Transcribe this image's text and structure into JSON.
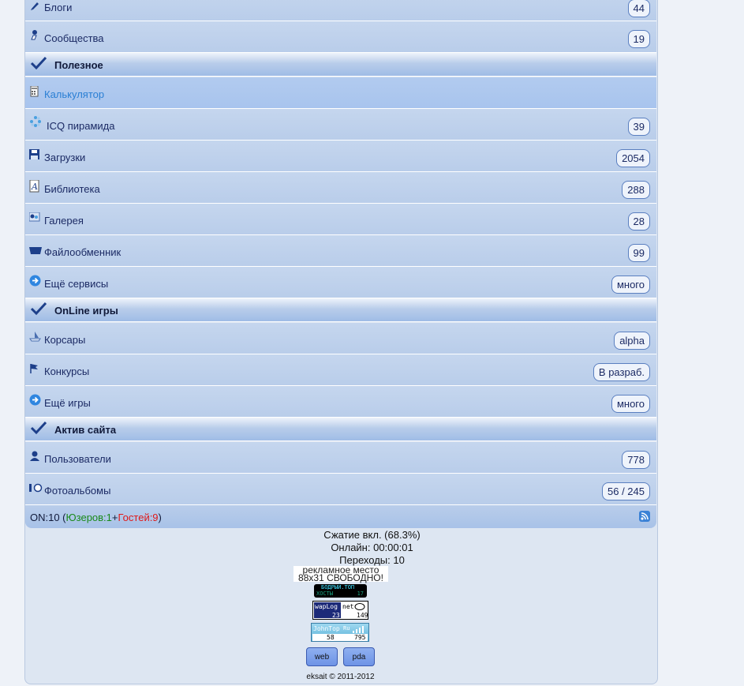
{
  "menu_top": [
    {
      "label": "Блоги",
      "count": "44",
      "icon": "pencil-icon"
    },
    {
      "label": "Сообщества",
      "count": "19",
      "icon": "community-icon"
    }
  ],
  "sections": {
    "useful": {
      "title": "Полезное"
    },
    "games": {
      "title": "OnLine игры"
    },
    "activity": {
      "title": "Актив сайта"
    }
  },
  "useful_items": [
    {
      "label": "Калькулятор",
      "count": "",
      "icon": "calculator-icon"
    },
    {
      "label": "ICQ пирамида",
      "count": "39",
      "icon": "icq-flower-icon"
    },
    {
      "label": "Загрузки",
      "count": "2054",
      "icon": "floppy-icon"
    },
    {
      "label": "Библиотека",
      "count": "288",
      "icon": "book-icon"
    },
    {
      "label": "Галерея",
      "count": "28",
      "icon": "gallery-icon"
    },
    {
      "label": "Файлообменник",
      "count": "99",
      "icon": "tray-icon"
    },
    {
      "label": "Ещё сервисы",
      "count": "много",
      "icon": "arrow-circle-icon"
    }
  ],
  "game_items": [
    {
      "label": "Корсары",
      "count": "alpha",
      "icon": "ship-icon"
    },
    {
      "label": "Конкурсы",
      "count": "В разраб.",
      "icon": "flag-icon"
    },
    {
      "label": "Ещё игры",
      "count": "много",
      "icon": "arrow-circle-icon"
    }
  ],
  "activity_items": [
    {
      "label": "Пользователи",
      "count": "778",
      "icon": "user-icon"
    },
    {
      "label": "Фотоальбомы",
      "count": "56 / 245",
      "icon": "camera-icon"
    }
  ],
  "online": {
    "prefix": "ON:10 (",
    "users": "Юзеров:1",
    "plus": "+",
    "guests": "Гостей:9",
    "suffix": ")"
  },
  "footer": {
    "compression": "Сжатие вкл. (68.3%)",
    "online_time": "Онлайн: 00:00:01",
    "transitions": "Переходы: 10",
    "ad_line1": "рекламное место",
    "ad_line2": "88x31 СВОБОДНО!",
    "counter1_title": "БОДРЫЙ.ТОП",
    "counter1_sub": "ХОСТЫ",
    "counter1_value": "17",
    "counter2_brand": "wapLog",
    "counter2_domain": "net",
    "counter2_a": "23",
    "counter2_b": "149",
    "counter3_brand": "JohnTop",
    "counter3_ru": "Ru",
    "counter3_a": "58",
    "counter3_b": "795",
    "web_label": "web",
    "pda_label": "pda",
    "copyright": "eksait © 2011-2012"
  },
  "colors": {
    "row_bg": "#c5d6ee",
    "link": "#2a7fd4",
    "green": "#1a8a1a",
    "red": "#e01818"
  }
}
